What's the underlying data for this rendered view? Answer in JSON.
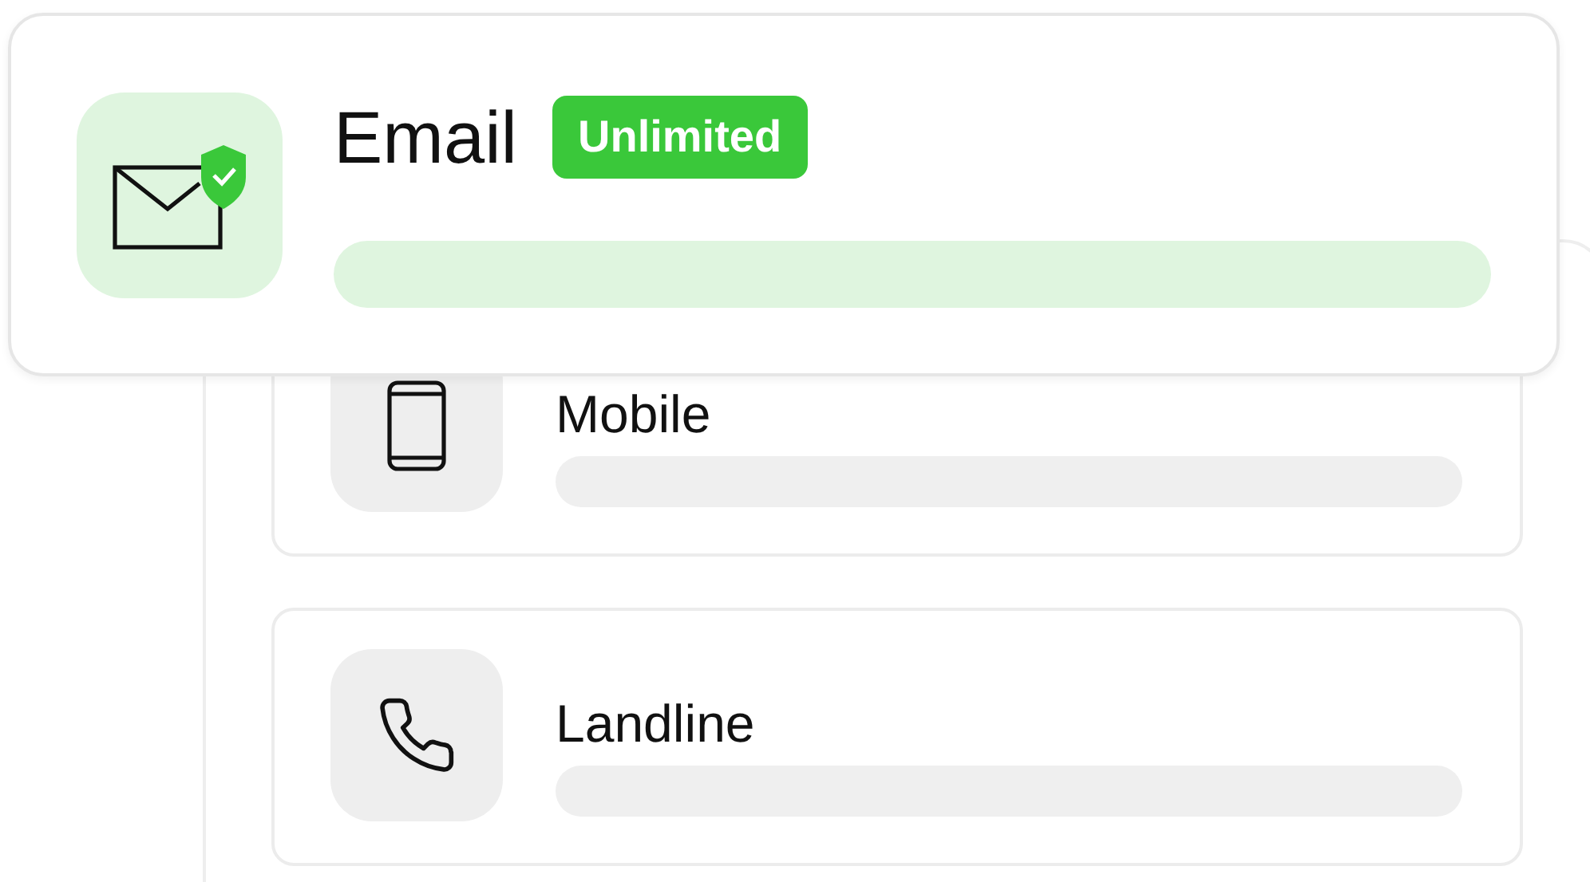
{
  "featured": {
    "title": "Email",
    "badge": "Unlimited"
  },
  "channels": [
    {
      "kind": "mobile",
      "name": "Mobile"
    },
    {
      "kind": "landline",
      "name": "Landline"
    }
  ]
}
